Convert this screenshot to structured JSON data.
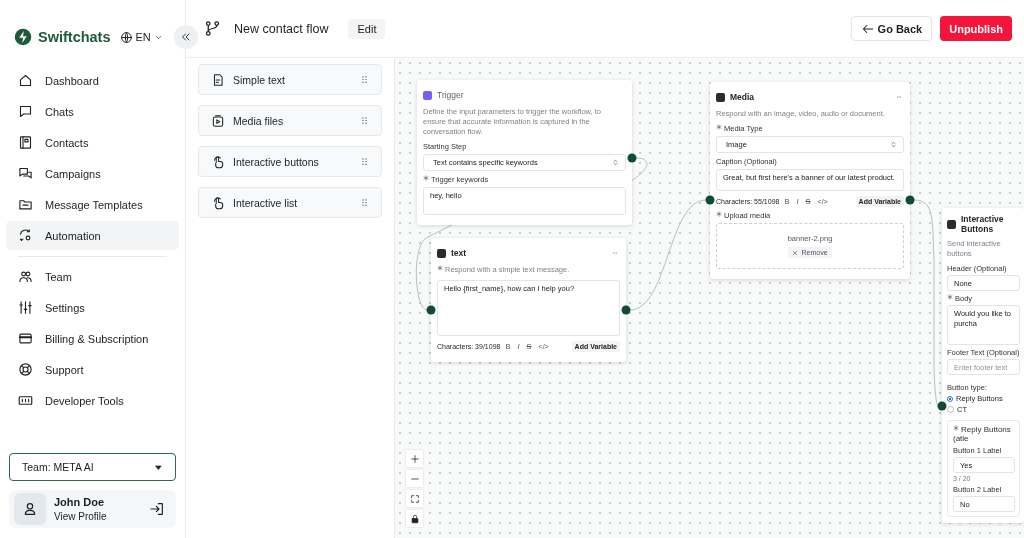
{
  "sidebar": {
    "brand": "Swiftchats",
    "language": "EN",
    "nav_groups": [
      {
        "items": [
          {
            "label": "Dashboard",
            "selected": false
          },
          {
            "label": "Chats",
            "selected": false
          },
          {
            "label": "Contacts",
            "selected": false
          },
          {
            "label": "Campaigns",
            "selected": false
          },
          {
            "label": "Message Templates",
            "selected": false
          },
          {
            "label": "Automation",
            "selected": true
          }
        ]
      },
      {
        "items": [
          {
            "label": "Team",
            "selected": false
          },
          {
            "label": "Settings",
            "selected": false
          },
          {
            "label": "Billing & Subscription",
            "selected": false
          },
          {
            "label": "Support",
            "selected": false
          },
          {
            "label": "Developer Tools",
            "selected": false
          }
        ]
      }
    ],
    "team_select": "Team: META AI",
    "user": {
      "name": "John Doe",
      "link": "View Profile"
    }
  },
  "header": {
    "title": "New contact flow",
    "edit": "Edit",
    "go_back": "Go Back",
    "unpublish": "Unpublish"
  },
  "palette": [
    {
      "label": "Simple text"
    },
    {
      "label": "Media files"
    },
    {
      "label": "Interactive buttons"
    },
    {
      "label": "Interactive list"
    }
  ],
  "nodes": [
    {
      "kind": "trigger",
      "title": "Trigger",
      "menu": false,
      "next_linked": true,
      "rows": [
        {
          "kind": "description",
          "text": "Define the input parameters to trigger the workflow, to ensure that accurate information is captured in the conversation flow."
        },
        {
          "kind": "label",
          "text": "Starting Step",
          "required": false
        },
        {
          "kind": "select",
          "value": "Text contains specific keywords"
        },
        {
          "kind": "label",
          "text": "Trigger keywords",
          "required": true
        },
        {
          "kind": "textarea",
          "value": "hey, hello"
        }
      ]
    },
    {
      "kind": "text",
      "title": "text",
      "menu": true,
      "next_linked": true,
      "rows": [
        {
          "kind": "description",
          "text": "Respond with a simple text message.",
          "required": true
        },
        {
          "kind": "textarea",
          "value": "Hello {first_name}, how can I help you?"
        },
        {
          "kind": "toolbar",
          "counter": "Characters: 39/1098",
          "tools": [
            {
              "kind": "bold",
              "label": "B"
            },
            {
              "kind": "italic",
              "label": "I"
            },
            {
              "kind": "strike",
              "label": "S"
            },
            {
              "kind": "code",
              "label": "</>"
            }
          ],
          "add_variable": "Add Variable"
        }
      ]
    },
    {
      "kind": "media",
      "title": "Media",
      "menu": true,
      "next_linked": true,
      "rows": [
        {
          "kind": "description",
          "text": "Respond with an image, video, audio or document."
        },
        {
          "kind": "label",
          "text": "Media Type",
          "required": true
        },
        {
          "kind": "select",
          "value": "Image"
        },
        {
          "kind": "label",
          "text": "Caption (Optional)",
          "required": false
        },
        {
          "kind": "textarea",
          "value": "Great, but first here's a banner of our latest product."
        },
        {
          "kind": "toolbar",
          "counter": "Characters: 55/1098",
          "tools": [
            {
              "kind": "bold",
              "label": "B"
            },
            {
              "kind": "italic",
              "label": "I"
            },
            {
              "kind": "strike",
              "label": "S"
            },
            {
              "kind": "code",
              "label": "</>"
            }
          ],
          "add_variable": "Add Variable"
        },
        {
          "kind": "label",
          "text": "Upload media",
          "required": true
        },
        {
          "kind": "upload",
          "file": "banner-2.png",
          "remove": "Remove"
        }
      ]
    },
    {
      "kind": "interactive",
      "title": "Interactive Buttons",
      "menu": false,
      "next_linked": false,
      "rows": [
        {
          "kind": "description",
          "text": "Send interactive buttons"
        },
        {
          "kind": "label",
          "text": "Header (Optional)",
          "required": false
        },
        {
          "kind": "input",
          "value": "None"
        },
        {
          "kind": "label",
          "text": "Body",
          "required": true
        },
        {
          "kind": "textarea",
          "value": "Would you like to purcha"
        },
        {
          "kind": "label",
          "text": "Footer Text (Optional)",
          "required": false
        },
        {
          "kind": "input",
          "placeholder": "Enter footer text"
        },
        {
          "kind": "radio",
          "text": "Button type:",
          "options": [
            {
              "label": "Reply Buttons",
              "selected": true
            },
            {
              "label": "CT",
              "selected": false
            }
          ]
        },
        {
          "kind": "group",
          "rows": [
            {
              "kind": "label",
              "text": "Reply Buttons (atle",
              "required": true
            },
            {
              "kind": "label",
              "text": "Button 1 Label",
              "required": false
            },
            {
              "kind": "input",
              "value": "Yes"
            },
            {
              "kind": "counter",
              "text": "3 / 20"
            },
            {
              "kind": "label",
              "text": "Button 2 Label",
              "required": false
            },
            {
              "kind": "input",
              "value": "No"
            }
          ]
        }
      ]
    }
  ]
}
